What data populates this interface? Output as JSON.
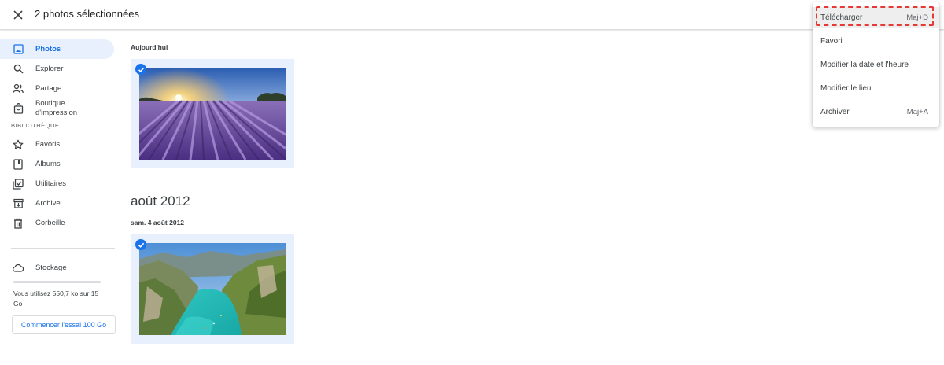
{
  "topbar": {
    "selection_title": "2 photos sélectionnées",
    "close_icon": "close-icon"
  },
  "sidebar": {
    "items": [
      {
        "label": "Photos",
        "icon": "photo-icon"
      },
      {
        "label": "Explorer",
        "icon": "search-icon"
      },
      {
        "label": "Partage",
        "icon": "people-icon"
      },
      {
        "label": "Boutique d'impression",
        "icon": "bag-icon"
      }
    ],
    "library_label": "BIBLIOTHÈQUE",
    "library_items": [
      {
        "label": "Favoris",
        "icon": "star-icon"
      },
      {
        "label": "Albums",
        "icon": "album-icon"
      },
      {
        "label": "Utilitaires",
        "icon": "utilities-icon"
      },
      {
        "label": "Archive",
        "icon": "archive-icon"
      },
      {
        "label": "Corbeille",
        "icon": "trash-icon"
      }
    ],
    "storage": {
      "label": "Stockage",
      "usage_text": "Vous utilisez 550,7 ko sur 15 Go",
      "trial_button": "Commencer l'essai 100 Go"
    }
  },
  "main": {
    "today_label": "Aujourd'hui",
    "month_heading": "août 2012",
    "date_label": "sam. 4 août 2012",
    "photos": [
      {
        "subject": "lavender-field-sunset",
        "selected": true
      },
      {
        "subject": "turquoise-river-gorge",
        "selected": true
      }
    ]
  },
  "menu": {
    "items": [
      {
        "label": "Télécharger",
        "shortcut": "Maj+D"
      },
      {
        "label": "Favori",
        "shortcut": ""
      },
      {
        "label": "Modifier la date et l'heure",
        "shortcut": ""
      },
      {
        "label": "Modifier le lieu",
        "shortcut": ""
      },
      {
        "label": "Archiver",
        "shortcut": "Maj+A"
      }
    ]
  },
  "colors": {
    "accent": "#1a73e8",
    "selected_bg": "#e8f0fe",
    "highlight_border": "#e53935"
  }
}
